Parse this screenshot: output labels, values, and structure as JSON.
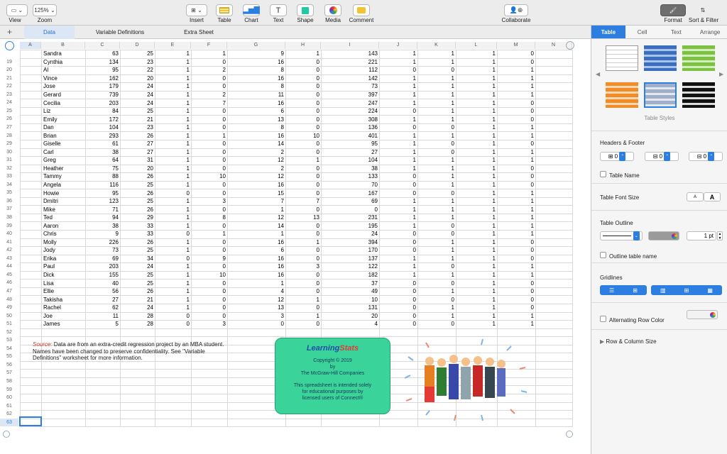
{
  "toolbar": {
    "view_label": "View",
    "zoom_value": "125%",
    "zoom_label": "Zoom",
    "insert_label": "Insert",
    "table_label": "Table",
    "chart_label": "Chart",
    "text_label": "Text",
    "shape_label": "Shape",
    "media_label": "Media",
    "comment_label": "Comment",
    "collaborate_label": "Collaborate",
    "format_label": "Format",
    "sort_filter_label": "Sort & Filter",
    "add_sheet_symbol": "+"
  },
  "sheet_tabs": [
    "Data",
    "Variable Definitions",
    "Extra Sheet"
  ],
  "columns": [
    "A",
    "B",
    "C",
    "D",
    "E",
    "F",
    "G",
    "H",
    "I",
    "J",
    "K",
    "L",
    "M",
    "N"
  ],
  "rows": [
    {
      "n": "",
      "d": [
        "Sandra",
        "63",
        "25",
        "1",
        "1",
        "9",
        "1",
        "143",
        "1",
        "1",
        "1",
        "0"
      ]
    },
    {
      "n": "19",
      "d": [
        "Cynthia",
        "134",
        "23",
        "1",
        "0",
        "16",
        "0",
        "221",
        "1",
        "1",
        "1",
        "0"
      ]
    },
    {
      "n": "20",
      "d": [
        "Al",
        "95",
        "22",
        "1",
        "2",
        "8",
        "0",
        "112",
        "0",
        "0",
        "1",
        "1"
      ]
    },
    {
      "n": "21",
      "d": [
        "Vince",
        "162",
        "20",
        "1",
        "0",
        "16",
        "0",
        "142",
        "1",
        "1",
        "1",
        "1"
      ]
    },
    {
      "n": "22",
      "d": [
        "Jose",
        "179",
        "24",
        "1",
        "0",
        "8",
        "0",
        "73",
        "1",
        "1",
        "1",
        "1"
      ]
    },
    {
      "n": "23",
      "d": [
        "Gerard",
        "739",
        "24",
        "1",
        "2",
        "11",
        "0",
        "397",
        "1",
        "1",
        "1",
        "1"
      ]
    },
    {
      "n": "24",
      "d": [
        "Cecilia",
        "203",
        "24",
        "1",
        "7",
        "16",
        "0",
        "247",
        "1",
        "1",
        "1",
        "0"
      ]
    },
    {
      "n": "25",
      "d": [
        "Liz",
        "84",
        "25",
        "1",
        "0",
        "6",
        "0",
        "224",
        "0",
        "1",
        "1",
        "0"
      ]
    },
    {
      "n": "26",
      "d": [
        "Emily",
        "172",
        "21",
        "1",
        "0",
        "13",
        "0",
        "308",
        "1",
        "1",
        "1",
        "0"
      ]
    },
    {
      "n": "27",
      "d": [
        "Dan",
        "104",
        "23",
        "1",
        "0",
        "8",
        "0",
        "136",
        "0",
        "0",
        "1",
        "1"
      ]
    },
    {
      "n": "28",
      "d": [
        "Brian",
        "293",
        "26",
        "1",
        "1",
        "16",
        "10",
        "401",
        "1",
        "1",
        "1",
        "1"
      ]
    },
    {
      "n": "29",
      "d": [
        "Giselle",
        "61",
        "27",
        "1",
        "0",
        "14",
        "0",
        "95",
        "1",
        "0",
        "1",
        "0"
      ]
    },
    {
      "n": "30",
      "d": [
        "Carl",
        "38",
        "27",
        "1",
        "0",
        "2",
        "0",
        "27",
        "1",
        "0",
        "1",
        "1"
      ]
    },
    {
      "n": "31",
      "d": [
        "Greg",
        "64",
        "31",
        "1",
        "0",
        "12",
        "1",
        "104",
        "1",
        "1",
        "1",
        "1"
      ]
    },
    {
      "n": "32",
      "d": [
        "Heather",
        "75",
        "20",
        "1",
        "0",
        "2",
        "0",
        "38",
        "1",
        "1",
        "1",
        "0"
      ]
    },
    {
      "n": "33",
      "d": [
        "Tammy",
        "88",
        "26",
        "1",
        "10",
        "12",
        "0",
        "133",
        "0",
        "1",
        "1",
        "0"
      ]
    },
    {
      "n": "34",
      "d": [
        "Angela",
        "116",
        "25",
        "1",
        "0",
        "16",
        "0",
        "70",
        "0",
        "1",
        "1",
        "0"
      ]
    },
    {
      "n": "35",
      "d": [
        "Howie",
        "95",
        "26",
        "0",
        "0",
        "15",
        "0",
        "167",
        "0",
        "0",
        "1",
        "1"
      ]
    },
    {
      "n": "36",
      "d": [
        "Dmitri",
        "123",
        "25",
        "1",
        "3",
        "7",
        "7",
        "69",
        "1",
        "1",
        "1",
        "1"
      ]
    },
    {
      "n": "37",
      "d": [
        "Mike",
        "71",
        "26",
        "1",
        "0",
        "1",
        "0",
        "0",
        "1",
        "1",
        "1",
        "1"
      ]
    },
    {
      "n": "38",
      "d": [
        "Ted",
        "94",
        "29",
        "1",
        "8",
        "12",
        "13",
        "231",
        "1",
        "1",
        "1",
        "1"
      ]
    },
    {
      "n": "39",
      "d": [
        "Aaron",
        "38",
        "33",
        "1",
        "0",
        "14",
        "0",
        "195",
        "1",
        "0",
        "1",
        "1"
      ]
    },
    {
      "n": "40",
      "d": [
        "Chris",
        "9",
        "33",
        "0",
        "1",
        "1",
        "0",
        "24",
        "0",
        "0",
        "1",
        "1"
      ]
    },
    {
      "n": "41",
      "d": [
        "Molly",
        "226",
        "26",
        "1",
        "0",
        "16",
        "1",
        "394",
        "0",
        "1",
        "1",
        "0"
      ]
    },
    {
      "n": "42",
      "d": [
        "Jody",
        "73",
        "25",
        "1",
        "0",
        "6",
        "0",
        "170",
        "0",
        "1",
        "1",
        "0"
      ]
    },
    {
      "n": "43",
      "d": [
        "Erika",
        "69",
        "34",
        "0",
        "9",
        "16",
        "0",
        "137",
        "1",
        "1",
        "1",
        "0"
      ]
    },
    {
      "n": "44",
      "d": [
        "Paul",
        "203",
        "24",
        "1",
        "0",
        "16",
        "3",
        "122",
        "1",
        "0",
        "1",
        "1"
      ]
    },
    {
      "n": "45",
      "d": [
        "Dick",
        "155",
        "25",
        "1",
        "10",
        "16",
        "0",
        "182",
        "1",
        "1",
        "1",
        "1"
      ]
    },
    {
      "n": "46",
      "d": [
        "Lisa",
        "40",
        "25",
        "1",
        "0",
        "1",
        "0",
        "37",
        "0",
        "0",
        "1",
        "0"
      ]
    },
    {
      "n": "47",
      "d": [
        "Ellie",
        "56",
        "26",
        "1",
        "0",
        "4",
        "0",
        "49",
        "0",
        "1",
        "1",
        "0"
      ]
    },
    {
      "n": "48",
      "d": [
        "Takisha",
        "27",
        "21",
        "1",
        "0",
        "12",
        "1",
        "10",
        "0",
        "0",
        "1",
        "0"
      ]
    },
    {
      "n": "49",
      "d": [
        "Rachel",
        "62",
        "24",
        "1",
        "0",
        "13",
        "0",
        "131",
        "0",
        "1",
        "1",
        "0"
      ]
    },
    {
      "n": "50",
      "d": [
        "Joe",
        "11",
        "28",
        "0",
        "0",
        "3",
        "1",
        "20",
        "0",
        "1",
        "1",
        "1"
      ]
    },
    {
      "n": "51",
      "d": [
        "James",
        "5",
        "28",
        "0",
        "3",
        "0",
        "0",
        "4",
        "0",
        "0",
        "1",
        "1"
      ]
    },
    {
      "n": "52",
      "d": []
    },
    {
      "n": "53",
      "d": []
    },
    {
      "n": "54",
      "d": []
    },
    {
      "n": "55",
      "d": []
    },
    {
      "n": "56",
      "d": []
    },
    {
      "n": "57",
      "d": []
    },
    {
      "n": "58",
      "d": []
    },
    {
      "n": "59",
      "d": []
    },
    {
      "n": "60",
      "d": []
    },
    {
      "n": "61",
      "d": []
    },
    {
      "n": "62",
      "d": []
    },
    {
      "n": "63",
      "d": []
    }
  ],
  "note": {
    "source_label": "Source:",
    "line1": " Data are from an extra-credit regression project by an MBA student.",
    "line2": "Names have been changed to preserve confidentiality.  See \"Variable",
    "line3": "Definitions\" worksheet for more information."
  },
  "learning_stats": {
    "logo_a": "Learning",
    "logo_b": "Stats",
    "copyright": "Copyright © 2019",
    "by": "by",
    "company": "The McGraw-Hill Companies",
    "line1": "This spreadsheet is intended solely",
    "line2": "for educational purposes by",
    "line3": "licensed users of Connect®"
  },
  "inspector": {
    "tabs": [
      "Table",
      "Cell",
      "Text",
      "Arrange"
    ],
    "table_styles_label": "Table Styles",
    "headers_footer_label": "Headers & Footer",
    "header_rows": "0",
    "header_cols": "0",
    "footer_rows": "0",
    "table_name_label": "Table Name",
    "font_size_label": "Table Font Size",
    "font_small": "A",
    "font_large": "A",
    "outline_label": "Table Outline",
    "outline_width": "1 pt",
    "outline_name_label": "Outline table name",
    "gridlines_label": "Gridlines",
    "alt_row_label": "Alternating Row Color",
    "row_col_size_label": "Row & Column Size"
  },
  "colors": {
    "accent": "#2c7fe1",
    "selected_tab_bg": "#dbe7f5",
    "logo_box": "#3ad39a"
  }
}
